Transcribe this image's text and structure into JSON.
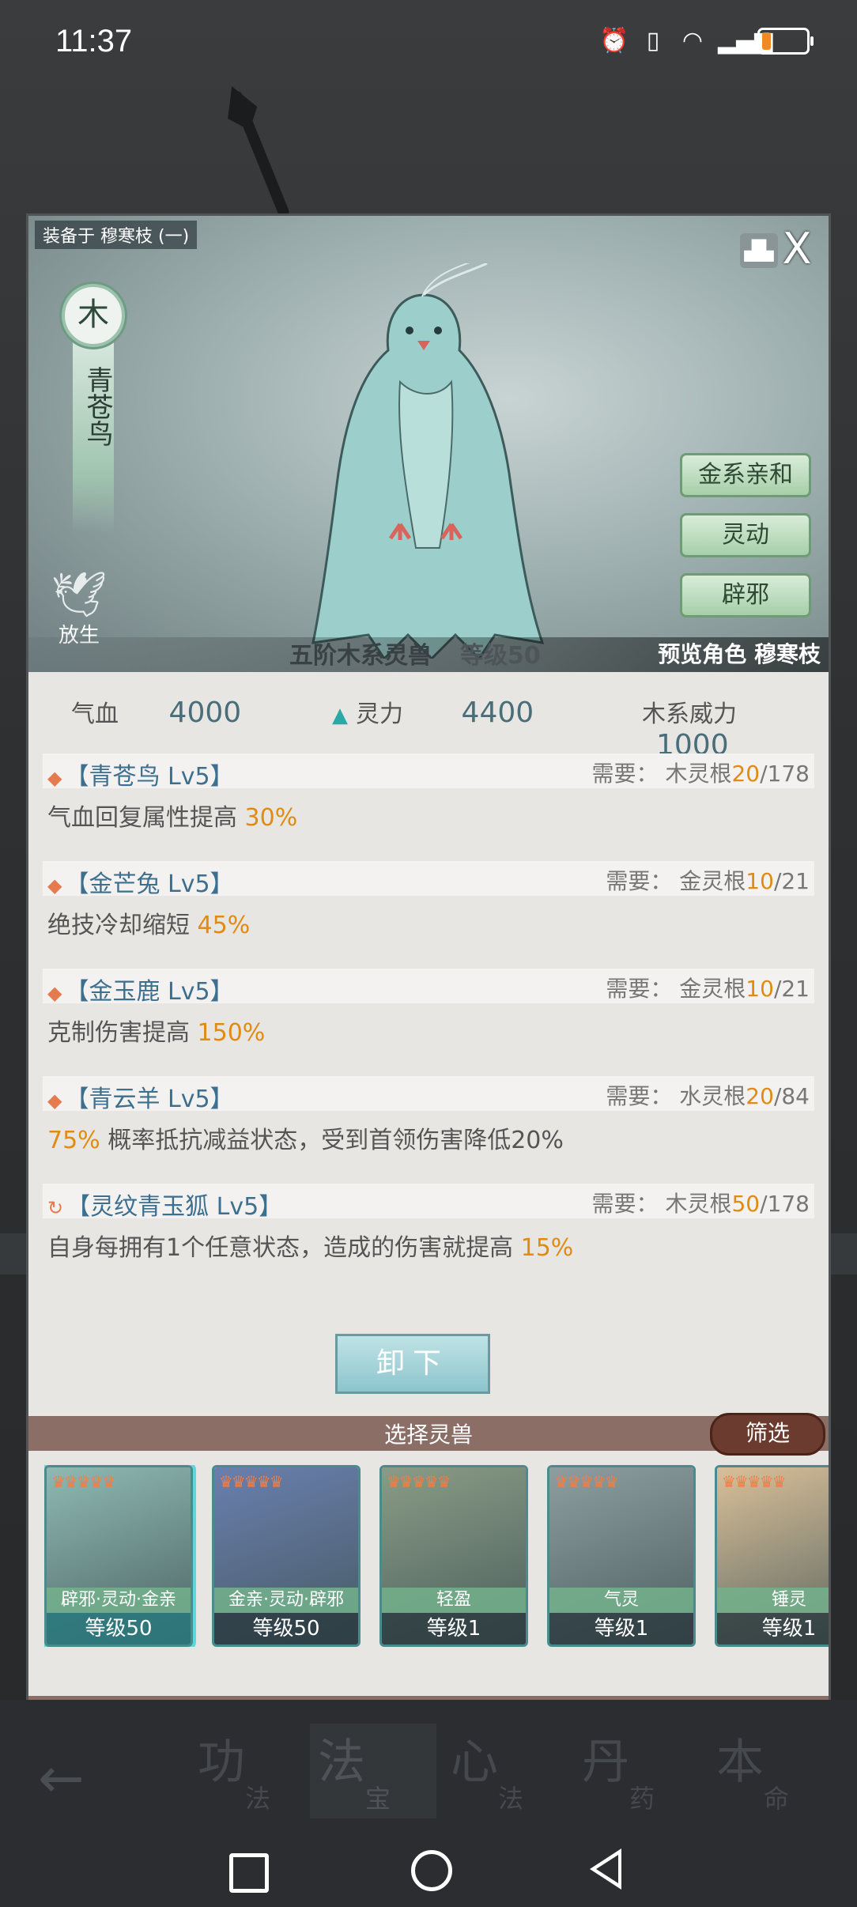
{
  "status_bar": {
    "time": "11:37",
    "battery_percent": 20
  },
  "hero": {
    "equipped_on": "装备于 穆寒枝 (一)",
    "element": "木",
    "beast_name": "青苍鸟",
    "release_label": "放生",
    "traits": [
      "金系亲和",
      "灵动",
      "辟邪"
    ],
    "tier_text": "五阶木系灵兽",
    "level_text": "等级50",
    "preview_text": "预览角色 穆寒枝",
    "close_symbol": "X"
  },
  "stats": {
    "hp_label": "气血",
    "hp_value": "4000",
    "spirit_label": "灵力",
    "spirit_value": "4400",
    "wood_power_label": "木系威力",
    "wood_power_value": "1000"
  },
  "skills": [
    {
      "name": "【青苍鸟 Lv5】",
      "req_label": "需要：",
      "req_root": "木灵根",
      "req_cur": "20",
      "req_max": "/178",
      "desc": "气血回复属性提高 ",
      "hl": "30%",
      "desc_after": "",
      "icon": "diamond-icon"
    },
    {
      "name": "【金芒兔 Lv5】",
      "req_label": "需要：",
      "req_root": "金灵根",
      "req_cur": "10",
      "req_max": "/21",
      "desc": "绝技冷却缩短 ",
      "hl": "45%",
      "desc_after": "",
      "icon": "diamond-icon"
    },
    {
      "name": "【金玉鹿 Lv5】",
      "req_label": "需要：",
      "req_root": "金灵根",
      "req_cur": "10",
      "req_max": "/21",
      "desc": "克制伤害提高 ",
      "hl": "150%",
      "desc_after": "",
      "icon": "diamond-icon"
    },
    {
      "name": "【青云羊 Lv5】",
      "req_label": "需要：",
      "req_root": "水灵根",
      "req_cur": "20",
      "req_max": "/84",
      "desc": "",
      "hl": "75%",
      "desc_after": " 概率抵抗减益状态，受到首领伤害降低20%",
      "icon": "diamond-icon"
    },
    {
      "name": "【灵纹青玉狐 Lv5】",
      "req_label": "需要：",
      "req_root": "木灵根",
      "req_cur": "50",
      "req_max": "/178",
      "desc": "自身每拥有1个任意状态，造成的伤害就提高 ",
      "hl": "15%",
      "desc_after": "",
      "icon": "refresh-icon"
    }
  ],
  "unequip_label": "卸下",
  "select_title": "选择灵兽",
  "filter_label": "筛选",
  "cards": [
    {
      "trait": "辟邪·灵动·金亲",
      "level": "等级50",
      "stars": "♛♛♛♛♛",
      "color": "#8fb9b3"
    },
    {
      "trait": "金亲·灵动·辟邪",
      "level": "等级50",
      "stars": "♛♛♛♛♛",
      "color": "#6a7fae"
    },
    {
      "trait": "轻盈",
      "level": "等级1",
      "stars": "♛♛♛♛♛",
      "color": "#8a9c86"
    },
    {
      "trait": "气灵",
      "level": "等级1",
      "stars": "♛♛♛♛♛",
      "color": "#8e9ea0"
    },
    {
      "trait": "锤灵",
      "level": "等级1",
      "stars": "♛♛♛♛♛",
      "color": "#d9bf98"
    }
  ],
  "tabs": [
    {
      "big": "功",
      "small": "法"
    },
    {
      "big": "法",
      "small": "宝"
    },
    {
      "big": "心",
      "small": "法"
    },
    {
      "big": "丹",
      "small": "药"
    },
    {
      "big": "本",
      "small": "命"
    }
  ]
}
